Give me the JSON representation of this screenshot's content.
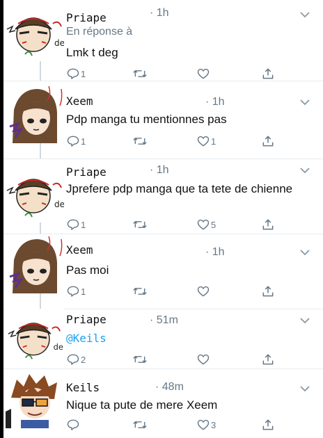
{
  "tweets": [
    {
      "name": "Priape",
      "time": "· 1h",
      "reply_label": "En réponse à",
      "text": "Lmk t deg",
      "reply_count": "1",
      "retweet_count": "",
      "like_count": ""
    },
    {
      "name": "Xeem",
      "time": "· 1h",
      "text": "Pdp manga tu mentionnes pas",
      "reply_count": "1",
      "retweet_count": "",
      "like_count": "1"
    },
    {
      "name": "Priape",
      "time": "· 1h",
      "text": "Jprefere pdp manga que ta tete de chienne",
      "reply_count": "1",
      "retweet_count": "",
      "like_count": "5"
    },
    {
      "name": "Xeem",
      "time": "· 1h",
      "text": "Pas moi",
      "reply_count": "1",
      "retweet_count": "",
      "like_count": ""
    },
    {
      "name": "Priape",
      "time": "· 51m",
      "text": "@Keils",
      "reply_count": "2",
      "retweet_count": "",
      "like_count": ""
    },
    {
      "name": "Keils",
      "time": "· 48m",
      "text": "Nique ta pute de mere Xeem",
      "reply_count": "",
      "retweet_count": "",
      "like_count": "3"
    }
  ],
  "icons": {
    "reply": "reply-icon",
    "retweet": "retweet-icon",
    "like": "heart-icon",
    "share": "share-icon",
    "more": "chevron-down-icon"
  },
  "colors": {
    "text": "#111111",
    "muted": "#657786",
    "link": "#1da1f2",
    "divider": "#e6ecf0"
  }
}
